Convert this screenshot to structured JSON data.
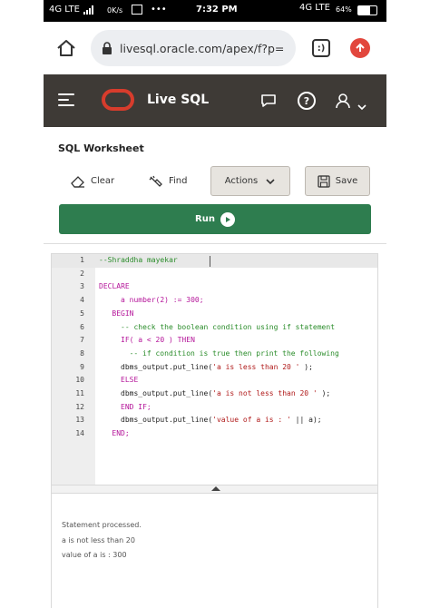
{
  "status_bar": {
    "network_left": "4G LTE",
    "speed": "0K/s",
    "dots": "•••",
    "time": "7:32 PM",
    "network_right": "4G LTE",
    "battery": "64%"
  },
  "browser": {
    "url": "livesql.oracle.com/apex/f?p=",
    "tab_count": ":)"
  },
  "app_header": {
    "title": "Live SQL",
    "help_glyph": "?"
  },
  "worksheet": {
    "title": "SQL Worksheet",
    "clear_label": "Clear",
    "find_label": "Find",
    "actions_label": "Actions",
    "save_label": "Save",
    "run_label": "Run"
  },
  "editor": {
    "lines": [
      {
        "n": "1",
        "text": "--Shraddha mayekar",
        "kind": "cm",
        "indent": 0
      },
      {
        "n": "2",
        "text": "",
        "kind": "pl",
        "indent": 0
      },
      {
        "n": "3",
        "text": "DECLARE",
        "kind": "kw",
        "indent": 0
      },
      {
        "n": "4",
        "text": "a number(2) := 300;",
        "kind": "kw",
        "indent": 5
      },
      {
        "n": "5",
        "text": "BEGIN",
        "kind": "kw",
        "indent": 3
      },
      {
        "n": "6",
        "text": "-- check the boolean condition using if statement",
        "kind": "cm",
        "indent": 5
      },
      {
        "n": "7",
        "text": "IF( a < 20 ) THEN",
        "kind": "kw",
        "indent": 5
      },
      {
        "n": "8",
        "text": "-- if condition is true then print the following",
        "kind": "cm",
        "indent": 7
      },
      {
        "n": "9",
        "text": "dbms_output.put_line('a is less than 20 ' );",
        "kind": "mix",
        "indent": 5
      },
      {
        "n": "10",
        "text": "ELSE",
        "kind": "kw",
        "indent": 5
      },
      {
        "n": "11",
        "text": "dbms_output.put_line('a is not less than 20 ' );",
        "kind": "mix",
        "indent": 5
      },
      {
        "n": "12",
        "text": "END IF;",
        "kind": "kw",
        "indent": 5
      },
      {
        "n": "13",
        "text": "dbms_output.put_line('value of a is : ' || a);",
        "kind": "mix",
        "indent": 5
      },
      {
        "n": "14",
        "text": "END;",
        "kind": "kw",
        "indent": 3
      }
    ]
  },
  "results": {
    "lines": [
      "Statement processed.",
      "a is not less than 20",
      "value of a is : 300"
    ]
  },
  "colors": {
    "header_bg": "#3e3a36",
    "oracle_red": "#d73c2c",
    "run_green": "#2e7d4f",
    "keyword": "#b5169a",
    "comment": "#2a8c2a",
    "string": "#b01a1a"
  }
}
